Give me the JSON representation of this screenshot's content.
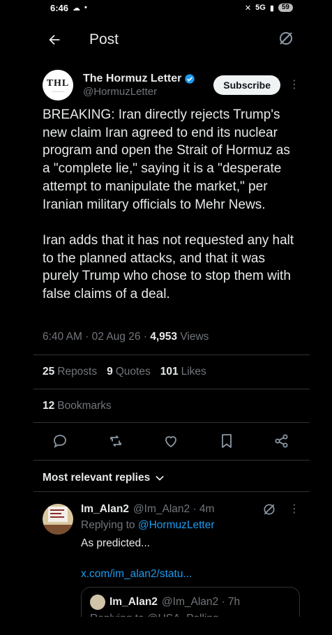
{
  "status_bar": {
    "time": "6:46",
    "network": "5G",
    "battery": "59"
  },
  "header": {
    "title": "Post"
  },
  "post": {
    "author_initials": "THL",
    "author_name": "The Hormuz Letter",
    "author_handle": "@HormuzLetter",
    "subscribe_label": "Subscribe",
    "paragraph_1": "BREAKING: Iran directly rejects Trump's new claim Iran agreed to end its nuclear program and open the Strait of Hormuz as a \"complete lie,\" saying it is a \"desperate attempt to manipulate the market,\" per Iranian military officials to Mehr News.",
    "paragraph_2": "Iran adds that it has not requested any halt to the planned attacks, and that it was purely Trump who chose to stop them with false claims of a deal.",
    "timestamp": "6:40 AM · 02 Aug 26 · ",
    "views_count": "4,953",
    "views_label": "Views",
    "reposts_count": "25",
    "reposts_label": "Reposts",
    "quotes_count": "9",
    "quotes_label": "Quotes",
    "likes_count": "101",
    "likes_label": "Likes",
    "bookmarks_count": "12",
    "bookmarks_label": "Bookmarks"
  },
  "actions": [
    "reply-icon",
    "repost-icon",
    "like-icon",
    "bookmark-icon",
    "share-icon"
  ],
  "replies": {
    "sort_label": "Most relevant replies",
    "items": [
      {
        "name": "Im_Alan2",
        "handle": "@Im_Alan2 · 4m",
        "replying_prefix": "Replying to ",
        "replying_to": "@HormuzLetter",
        "text": "As predicted...",
        "link": "x.com/im_alan2/statu...",
        "quote": {
          "name": "Im_Alan2",
          "handle": "@Im_Alan2 · 7h",
          "partial": "Replying to @USA_Polling..."
        }
      }
    ]
  },
  "colors": {
    "accent": "#1d9bf0",
    "verified": "#1d9bf0",
    "background": "#000000",
    "secondary_text": "#71767b"
  }
}
